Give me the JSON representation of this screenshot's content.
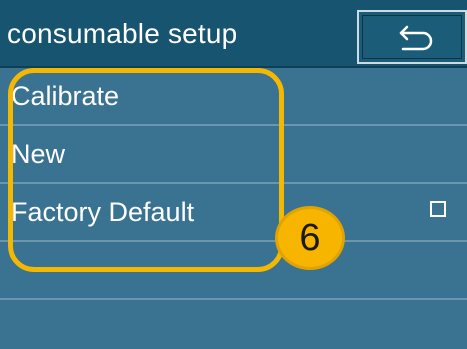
{
  "header": {
    "title": "consumable setup",
    "back_icon": "return-arrow-icon"
  },
  "menu": {
    "items": [
      {
        "label": "Calibrate"
      },
      {
        "label": "New"
      },
      {
        "label": "Factory Default",
        "checkbox_checked": false
      },
      {
        "label": ""
      },
      {
        "label": ""
      }
    ]
  },
  "annotation": {
    "callout_number": "6",
    "highlight_color": "#f5b800"
  },
  "colors": {
    "header_bg": "#17546f",
    "list_bg": "#3a7292",
    "divider": "#6d96ad",
    "text": "#ffffff"
  }
}
